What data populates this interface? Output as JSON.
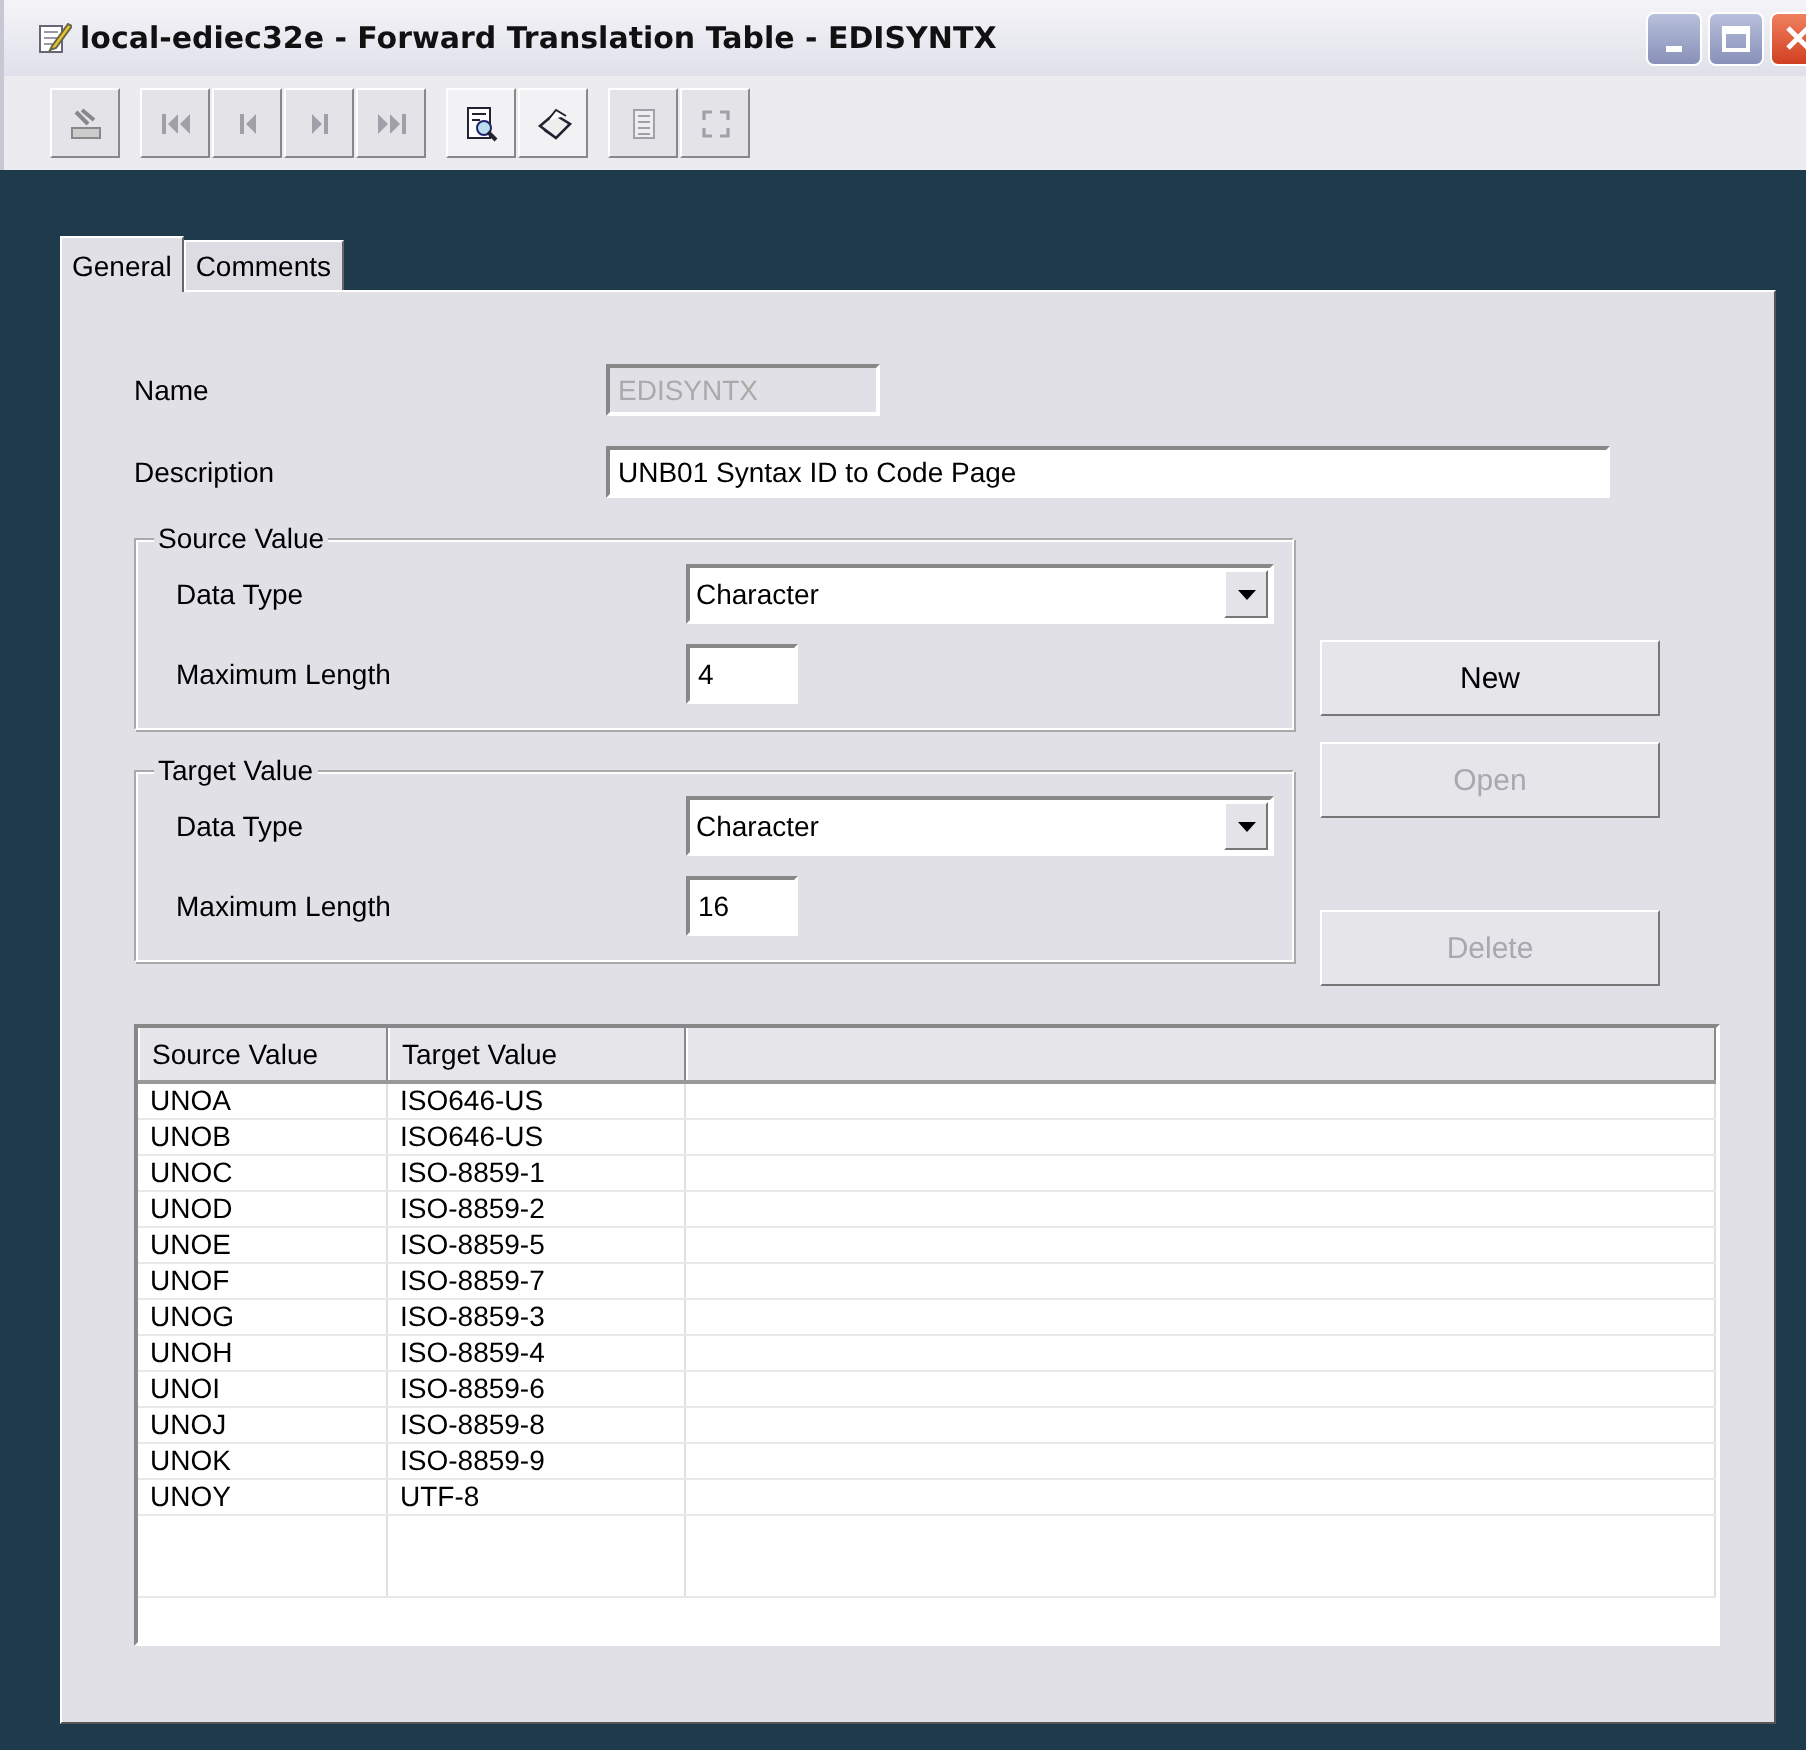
{
  "window": {
    "title": "local-ediec32e - Forward Translation Table - EDISYNTX",
    "controls": [
      {
        "kind": "minimize"
      },
      {
        "kind": "maximize"
      },
      {
        "kind": "close"
      }
    ]
  },
  "toolbar": [
    [
      {
        "kind": "tray",
        "disabled": true
      }
    ],
    [
      {
        "kind": "first",
        "disabled": true
      },
      {
        "kind": "previous",
        "disabled": true
      },
      {
        "kind": "next",
        "disabled": true
      },
      {
        "kind": "last",
        "disabled": true
      }
    ],
    [
      {
        "kind": "preview",
        "disabled": false
      },
      {
        "kind": "print",
        "disabled": false
      }
    ],
    [
      {
        "kind": "list",
        "disabled": true
      },
      {
        "kind": "refresh",
        "disabled": true
      }
    ]
  ],
  "tabs": [
    {
      "label": "General",
      "selected": true
    },
    {
      "label": "Comments",
      "selected": false
    }
  ],
  "form": {
    "name": {
      "label": "Name",
      "value": "EDISYNTX",
      "disabled": true
    },
    "description": {
      "label": "Description",
      "value": "UNB01 Syntax ID to Code Page",
      "disabled": false
    }
  },
  "groups": [
    {
      "title": "Source Value",
      "data_type": {
        "label": "Data Type",
        "value": "Character"
      },
      "max_length": {
        "label": "Maximum Length",
        "value": "4"
      }
    },
    {
      "title": "Target Value",
      "data_type": {
        "label": "Data Type",
        "value": "Character"
      },
      "max_length": {
        "label": "Maximum Length",
        "value": "16"
      }
    }
  ],
  "buttons": [
    {
      "label": "New",
      "disabled": false
    },
    {
      "label": "Open",
      "disabled": true
    },
    {
      "label": "Delete",
      "disabled": true
    }
  ],
  "table": {
    "columns": [
      "Source Value",
      "Target Value"
    ],
    "rows": [
      [
        "UNOA",
        "ISO646-US"
      ],
      [
        "UNOB",
        "ISO646-US"
      ],
      [
        "UNOC",
        "ISO-8859-1"
      ],
      [
        "UNOD",
        "ISO-8859-2"
      ],
      [
        "UNOE",
        "ISO-8859-5"
      ],
      [
        "UNOF",
        "ISO-8859-7"
      ],
      [
        "UNOG",
        "ISO-8859-3"
      ],
      [
        "UNOH",
        "ISO-8859-4"
      ],
      [
        "UNOI",
        "ISO-8859-6"
      ],
      [
        "UNOJ",
        "ISO-8859-8"
      ],
      [
        "UNOK",
        "ISO-8859-9"
      ],
      [
        "UNOY",
        "UTF-8"
      ]
    ]
  }
}
